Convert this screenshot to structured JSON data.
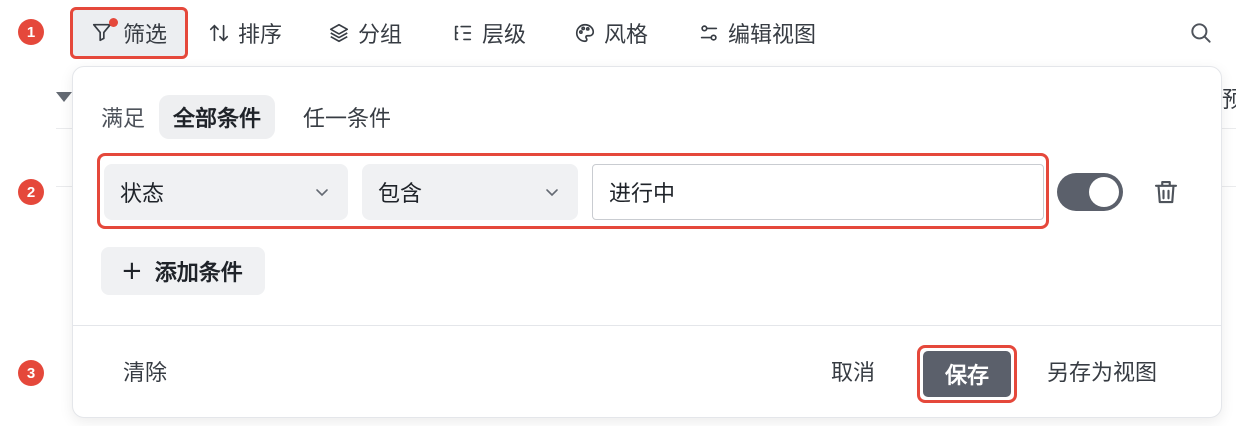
{
  "steps": [
    "1",
    "2",
    "3"
  ],
  "toolbar": {
    "filter": "筛选",
    "sort": "排序",
    "group": "分组",
    "level": "层级",
    "style": "风格",
    "edit_view": "编辑视图"
  },
  "background_partial_text": "预",
  "filter_panel": {
    "match_label": "满足",
    "match_all": "全部条件",
    "match_any": "任一条件",
    "condition": {
      "field": "状态",
      "operator": "包含",
      "value": "进行中",
      "enabled": true
    },
    "add_condition": "添加条件",
    "add_icon": "+",
    "clear": "清除",
    "cancel": "取消",
    "save": "保存",
    "save_as_view": "另存为视图"
  },
  "colors": {
    "highlight": "#e5483b",
    "primary_button": "#5b606b"
  }
}
